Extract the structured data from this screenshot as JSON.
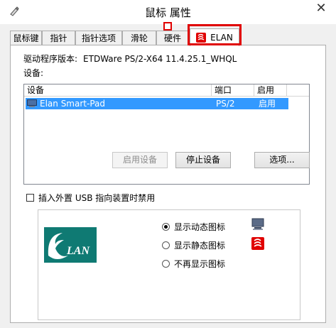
{
  "window": {
    "title": "鼠标 属性",
    "close_glyph": "✕"
  },
  "tabs": [
    {
      "label": "鼠标键",
      "active": false
    },
    {
      "label": "指针",
      "active": false
    },
    {
      "label": "指针选项",
      "active": false
    },
    {
      "label": "滑轮",
      "active": false
    },
    {
      "label": "硬件",
      "active": false
    },
    {
      "label": "ELAN",
      "active": true
    }
  ],
  "panel": {
    "driver_label": "驱动程序版本:",
    "driver_version": "ETDWare PS/2-X64 11.4.25.1_WHQL",
    "devices_label": "设备:",
    "columns": [
      "设备",
      "端口",
      "启用"
    ],
    "rows": [
      {
        "device": "Elan Smart-Pad",
        "port": "PS/2",
        "enabled": "启用",
        "selected": true
      }
    ],
    "buttons": {
      "enable": "启用设备",
      "disable": "停止设备",
      "options": "选项..."
    },
    "checkbox_label": "插入外置 USB 指向装置时禁用",
    "checkbox_checked": false,
    "logo_text": "LAN",
    "radios": [
      {
        "label": "显示动态图标",
        "checked": true,
        "icon": "monitor-icon"
      },
      {
        "label": "显示静态图标",
        "checked": false,
        "icon": "elan-red-icon"
      },
      {
        "label": "不再显示图标",
        "checked": false,
        "icon": ""
      }
    ]
  },
  "colors": {
    "selection": "#3399ff",
    "highlight": "#e00000",
    "elan_teal": "#0f7a73"
  }
}
